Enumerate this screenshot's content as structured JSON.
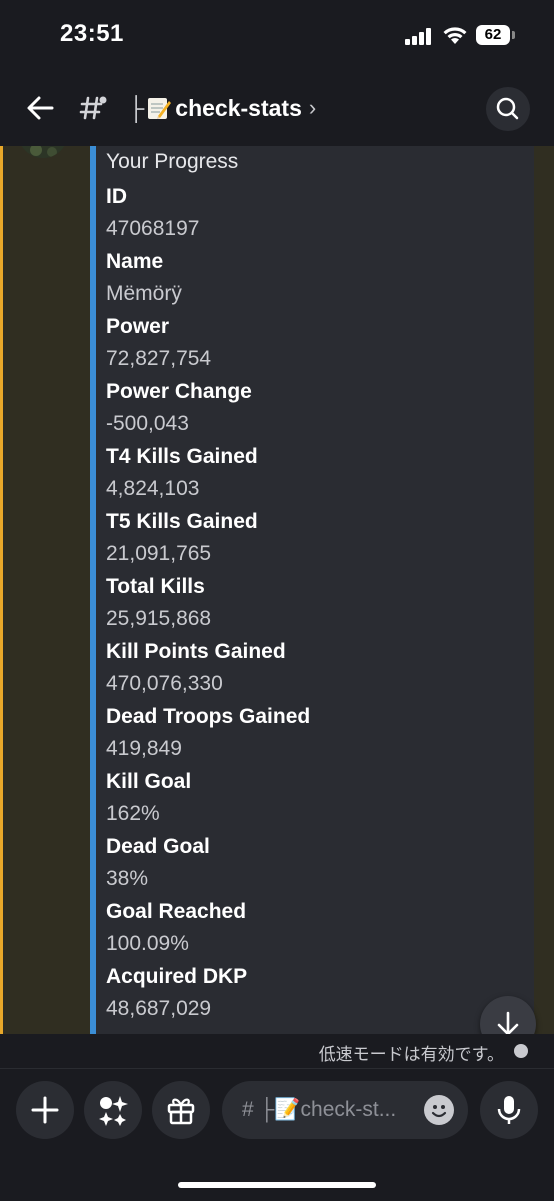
{
  "status": {
    "time": "23:51",
    "battery": "62",
    "icons": [
      "signal-icon",
      "wifi-icon",
      "battery-icon"
    ]
  },
  "header": {
    "back_icon": "arrow-left-icon",
    "channel_icon": "hash-icon",
    "separator": "├",
    "emoji": "memo-emoji",
    "channel_name": "check-stats",
    "chevron": "›",
    "search_icon": "search-icon"
  },
  "embed": {
    "title": "Your Progress",
    "accent_color": "#3b8ed6",
    "fields": [
      {
        "name": "ID",
        "value": "47068197"
      },
      {
        "name": "Name",
        "value": "Mëmörÿ"
      },
      {
        "name": "Power",
        "value": "72,827,754"
      },
      {
        "name": "Power Change",
        "value": "-500,043"
      },
      {
        "name": "T4 Kills Gained",
        "value": "4,824,103"
      },
      {
        "name": "T5 Kills Gained",
        "value": "21,091,765"
      },
      {
        "name": "Total Kills",
        "value": "25,915,868"
      },
      {
        "name": "Kill Points Gained",
        "value": "470,076,330"
      },
      {
        "name": "Dead Troops Gained",
        "value": "419,849"
      },
      {
        "name": "Kill Goal",
        "value": "162%"
      },
      {
        "name": "Dead Goal",
        "value": "38%"
      },
      {
        "name": "Goal Reached",
        "value": "100.09%"
      },
      {
        "name": "Acquired DKP",
        "value": "48,687,029"
      }
    ]
  },
  "highlight_color": "#e8a82a",
  "slowmode": {
    "text": "低速モードは有効です。",
    "icon": "clock-check-icon"
  },
  "composer": {
    "add_icon": "plus-icon",
    "apps_icon": "sparkles-icon",
    "gift_icon": "gift-icon",
    "placeholder": "# ├📝check-st...",
    "emoji_icon": "smile-icon",
    "mic_icon": "microphone-icon"
  },
  "scroll_icon": "arrow-down-icon"
}
